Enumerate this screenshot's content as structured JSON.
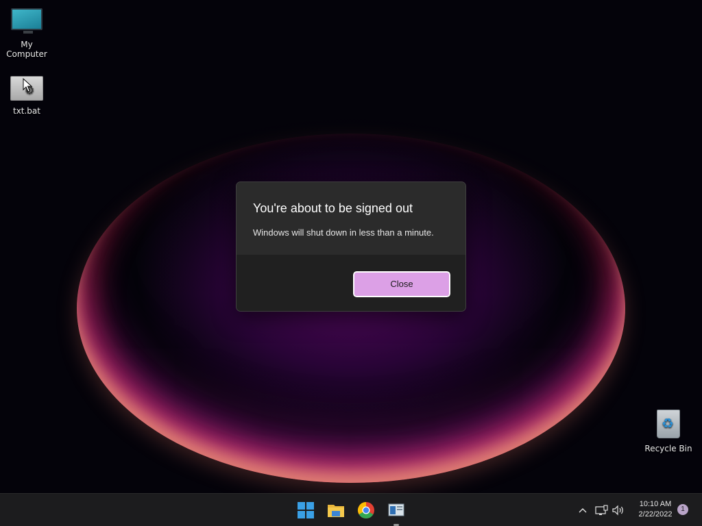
{
  "desktop": {
    "icons": [
      {
        "label": "My Computer",
        "icon": "monitor-icon"
      },
      {
        "label": "txt.bat",
        "icon": "batch-file-icon"
      },
      {
        "label": "Recycle Bin",
        "icon": "recycle-bin-icon"
      }
    ]
  },
  "dialog": {
    "title": "You're about to be signed out",
    "message": "Windows will shut down in less than a minute.",
    "close_label": "Close",
    "accent_color": "#dca0e6"
  },
  "taskbar": {
    "apps": [
      {
        "name": "Start",
        "icon": "windows-start-icon"
      },
      {
        "name": "File Explorer",
        "icon": "folder-icon"
      },
      {
        "name": "Google Chrome",
        "icon": "chrome-icon"
      },
      {
        "name": "Program window",
        "icon": "app-window-icon",
        "running": true
      }
    ],
    "tray": {
      "chevron_icon": "chevron-up-icon",
      "network_icon": "network-icon",
      "volume_icon": "volume-icon",
      "time": "10:10 AM",
      "date": "2/22/2022",
      "notification_count": "1"
    }
  }
}
